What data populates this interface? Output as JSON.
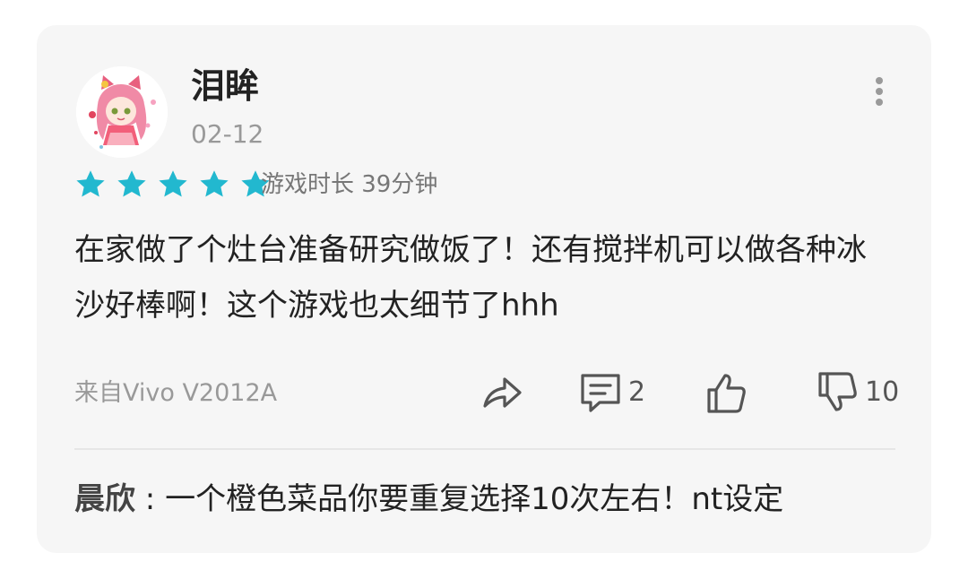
{
  "review": {
    "username": "泪眸",
    "date": "02-12",
    "rating": 5,
    "rating_max": 5,
    "star_color": "#22b8cf",
    "playtime": "游戏时长 39分钟",
    "content": "在家做了个灶台准备研究做饭了！还有搅拌机可以做各种冰沙好棒啊！这个游戏也太细节了hhh",
    "device": "来自Vivo V2012A",
    "actions": {
      "share_icon": "share-arrow-icon",
      "comment_icon": "comment-icon",
      "comment_count": "2",
      "like_icon": "thumbs-up-icon",
      "dislike_icon": "thumbs-down-icon",
      "dislike_count": "10"
    },
    "more_icon": "more-vertical-icon",
    "reply": {
      "author": "晨欣",
      "separator": " : ",
      "text": "一个橙色菜品你要重复选择10次左右！nt设定"
    }
  }
}
